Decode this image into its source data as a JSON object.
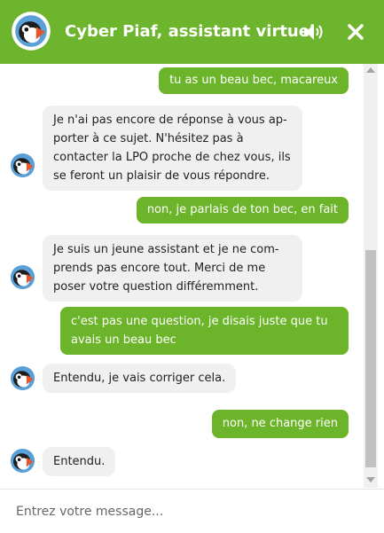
{
  "header": {
    "title": "Cyber Piaf, assistant virtuel",
    "speaker_icon": "speaker-icon",
    "close_icon": "close-icon",
    "color": "#6db52c"
  },
  "messages": [
    {
      "from": "user",
      "text": "tu as un beau bec, macareux"
    },
    {
      "from": "bot",
      "text": "Je n'ai pas encore de réponse à vous ap-porter à ce sujet. N'hésitez pas à contacter la LPO proche de chez vous, ils se feront un plaisir de vous répondre."
    },
    {
      "from": "user",
      "text": "non, je parlais de ton bec, en fait"
    },
    {
      "from": "bot",
      "text": "Je suis un jeune assistant et je ne com-prends pas encore tout. Merci de me poser votre question différemment."
    },
    {
      "from": "user",
      "text": "c'est pas une question, je disais juste que tu avais un beau bec"
    },
    {
      "from": "bot",
      "text": "Entendu, je vais corriger cela."
    },
    {
      "from": "user",
      "text": "non, ne change rien"
    },
    {
      "from": "bot",
      "text": "Entendu."
    }
  ],
  "input": {
    "placeholder": "Entrez votre message..."
  },
  "colors": {
    "user_bubble": "#6cb42a",
    "bot_bubble": "#f0f0f0",
    "avatar_ring": "#5aa0d8",
    "beak": "#e2572b"
  }
}
